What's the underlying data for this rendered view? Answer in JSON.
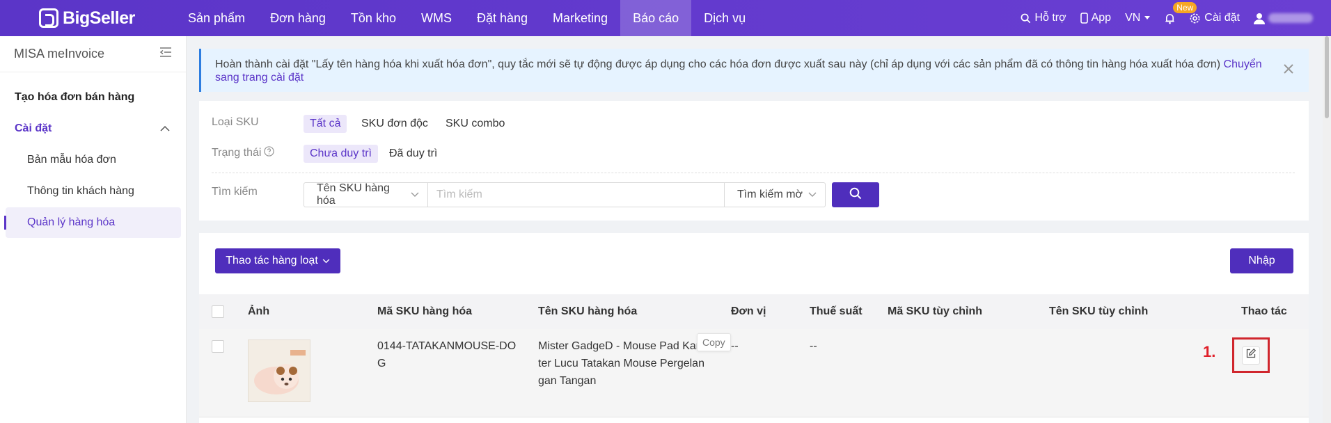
{
  "topbar": {
    "brand": "BigSeller",
    "nav": [
      "Sản phẩm",
      "Đơn hàng",
      "Tồn kho",
      "WMS",
      "Đặt hàng",
      "Marketing",
      "Báo cáo",
      "Dịch vụ"
    ],
    "active_nav": "Báo cáo",
    "support": "Hỗ trợ",
    "app": "App",
    "lang": "VN",
    "new_badge": "New",
    "settings": "Cài đặt"
  },
  "sidebar": {
    "title": "MISA meInvoice",
    "items": [
      {
        "label": "Tạo hóa đơn bán hàng"
      },
      {
        "label": "Cài đặt"
      },
      {
        "label": "Bản mẫu hóa đơn"
      },
      {
        "label": "Thông tin khách hàng"
      },
      {
        "label": "Quản lý hàng hóa"
      }
    ]
  },
  "alert": {
    "text": "Hoàn thành cài đặt \"Lấy tên hàng hóa khi xuất hóa đơn\", quy tắc mới sẽ tự động được áp dụng cho các hóa đơn được xuất sau này (chỉ áp dụng với các sản phẩm đã có thông tin hàng hóa xuất hóa đơn)",
    "link": "Chuyển sang trang cài đặt"
  },
  "filters": {
    "sku_type_label": "Loại SKU",
    "sku_type_options": [
      "Tất cả",
      "SKU đơn độc",
      "SKU combo"
    ],
    "status_label": "Trạng thái",
    "status_options": [
      "Chưa duy trì",
      "Đã duy trì"
    ],
    "search_label": "Tìm kiếm",
    "search_field": "Tên SKU hàng hóa",
    "search_placeholder": "Tìm kiếm",
    "search_mode": "Tìm kiếm mờ"
  },
  "actions": {
    "bulk": "Thao tác hàng loạt",
    "import": "Nhập"
  },
  "table": {
    "headers": [
      "Ảnh",
      "Mã SKU hàng hóa",
      "Tên SKU hàng hóa",
      "Đơn vị",
      "Thuế suất",
      "Mã SKU tùy chỉnh",
      "Tên SKU tùy chỉnh",
      "Thao tác"
    ],
    "rows": [
      {
        "sku_code": "0144-TATAKANMOUSE-DOG",
        "sku_code_lines": [
          "0144-TATAKANMOUSE-DO",
          "G"
        ],
        "sku_name_lines": [
          "Mister GadgeD - Mouse Pad Kara",
          "ter Lucu Tatakan Mouse Pergelan",
          "gan Tangan"
        ],
        "unit": "--",
        "tax": "--",
        "copy_tip": "Copy"
      }
    ]
  },
  "annotation": {
    "step": "1."
  },
  "colors": {
    "brand": "#5b35c8",
    "button": "#4f2ebc",
    "highlight": "#d0262d",
    "alert_bg": "#e6f3ff"
  }
}
